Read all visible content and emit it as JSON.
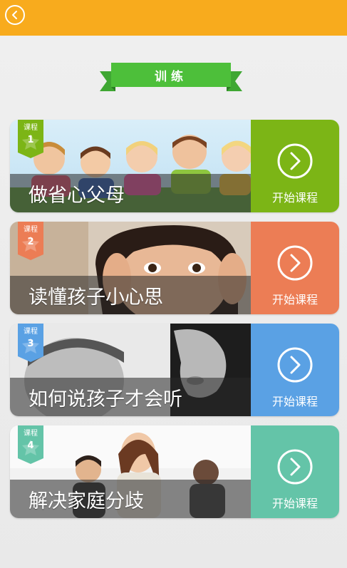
{
  "header": {
    "back_icon": "chevron-left-circle-icon",
    "color": "#f8ab1d"
  },
  "section": {
    "title": "训练",
    "color": "#4dbf3a"
  },
  "courses": [
    {
      "tag": "课程",
      "number": "1",
      "title": "做省心父母",
      "action": "开始课程",
      "accent": "#7cb516",
      "ribbon": "#7cb516"
    },
    {
      "tag": "课程",
      "number": "2",
      "title": "读懂孩子小心思",
      "action": "开始课程",
      "accent": "#ec7d55",
      "ribbon": "#ec7d55"
    },
    {
      "tag": "课程",
      "number": "3",
      "title": "如何说孩子才会听",
      "action": "开始课程",
      "accent": "#5aa1e4",
      "ribbon": "#5aa1e4"
    },
    {
      "tag": "课程",
      "number": "4",
      "title": "解决家庭分歧",
      "action": "开始课程",
      "accent": "#64c4a8",
      "ribbon": "#64c4a8"
    }
  ],
  "icons": {
    "action": "chevron-right-circle-icon"
  }
}
